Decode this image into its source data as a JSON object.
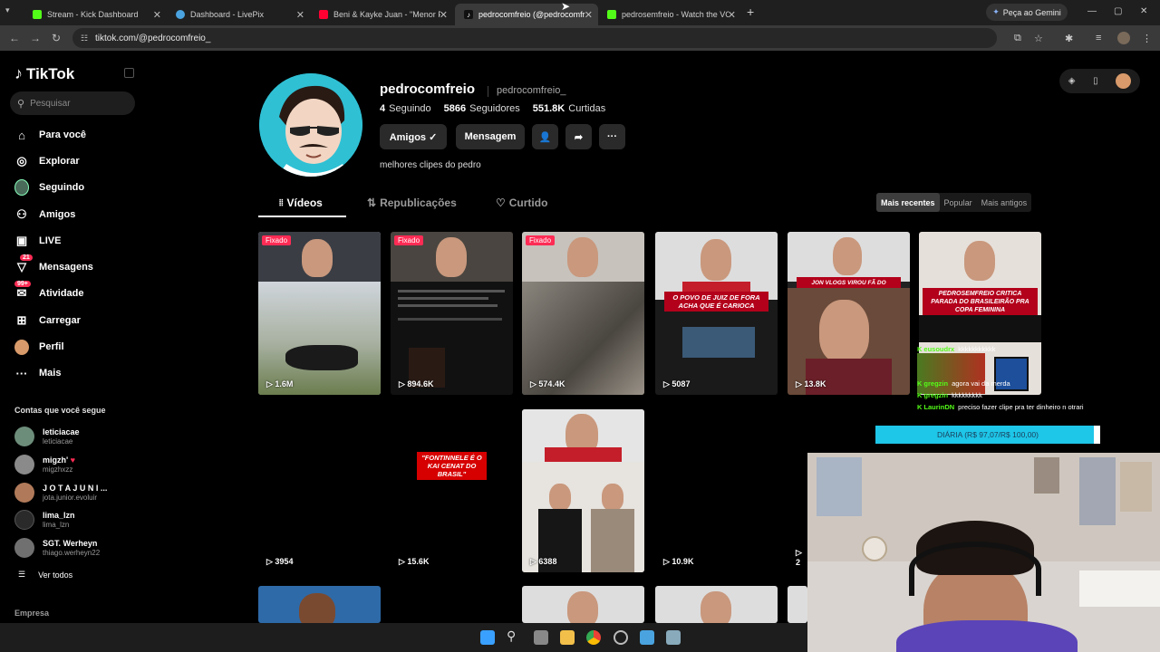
{
  "browser": {
    "tabs": [
      {
        "title": "Stream - Kick Dashboard",
        "color": "#53fc18"
      },
      {
        "title": "Dashboard - LivePix",
        "color": "#4aa3df"
      },
      {
        "title": "Beni & Kayke Juan - \"Menor Pr...",
        "color": "#ff0033"
      },
      {
        "title": "pedrocomfreio (@pedrocomfr...",
        "color": "#ffffff"
      },
      {
        "title": "pedrosemfreio - Watch the VOD",
        "color": "#53fc18"
      }
    ],
    "gemini_label": "Peça ao Gemini",
    "url": "tiktok.com/@pedrocomfreio_"
  },
  "sidebar": {
    "logo": "TikTok",
    "search_placeholder": "Pesquisar",
    "nav": [
      {
        "label": "Para você",
        "icon": "home-icon",
        "glyph": "⌂"
      },
      {
        "label": "Explorar",
        "icon": "compass-icon",
        "glyph": "◎"
      },
      {
        "label": "Seguindo",
        "icon": "following-avatar-icon",
        "glyph": ""
      },
      {
        "label": "Amigos",
        "icon": "friends-icon",
        "glyph": "👥"
      },
      {
        "label": "LIVE",
        "icon": "live-icon",
        "glyph": "▣"
      },
      {
        "label": "Mensagens",
        "icon": "messages-icon",
        "glyph": "✈",
        "badge": "21"
      },
      {
        "label": "Atividade",
        "icon": "activity-icon",
        "glyph": "✉",
        "badge": "99+"
      },
      {
        "label": "Carregar",
        "icon": "upload-icon",
        "glyph": "⊞"
      },
      {
        "label": "Perfil",
        "icon": "profile-avatar-icon",
        "glyph": ""
      },
      {
        "label": "Mais",
        "icon": "more-icon",
        "glyph": "···"
      }
    ],
    "following_heading": "Contas que você segue",
    "accounts": [
      {
        "name": "leticiacae",
        "handle": "leticiacae",
        "color": "#6c8d7a"
      },
      {
        "name": "migzh'",
        "handle": "migzhxzz",
        "color": "#8a8a8a"
      },
      {
        "name": "J O T A  J U N I ...",
        "handle": "jota.junior.evoluir",
        "color": "#b07a5a"
      },
      {
        "name": "lima_lzn",
        "handle": "lima_lzn",
        "color": "#2a2a2a"
      },
      {
        "name": "SGT. Werheyn",
        "handle": "thiago.werheyn22",
        "color": "#707070"
      }
    ],
    "see_all": "Ver todos",
    "company": "Empresa"
  },
  "profile": {
    "username": "pedrocomfreio",
    "handle": "pedrocomfreio_",
    "following_count": "4",
    "following_label": "Seguindo",
    "followers_count": "5866",
    "followers_label": "Seguidores",
    "likes_count": "551.8K",
    "likes_label": "Curtidas",
    "friends_button": "Amigos ✓",
    "message_button": "Mensagem",
    "bio": "melhores clipes do pedro",
    "tabs": [
      "Vídeos",
      "Republicações",
      "Curtido"
    ],
    "sort": [
      "Mais recentes",
      "Popular",
      "Mais antigos"
    ]
  },
  "videos": [
    {
      "views": "1.6M",
      "pinned": "Fixado"
    },
    {
      "views": "894.6K",
      "pinned": "Fixado"
    },
    {
      "views": "574.4K",
      "pinned": "Fixado"
    },
    {
      "views": "5087",
      "caption": "O POVO DE JUIZ DE FORA ACHA QUE É CARIOCA"
    },
    {
      "views": "13.8K",
      "caption": "JON VLOGS VIROU FÃ DO PEDROSEMFREIO"
    },
    {
      "caption": "PEDROSEMFREIO CRITICA PARADA DO BRASILEIRÃO PRA COPA FEMININA"
    },
    {
      "views": "3954"
    },
    {
      "views": "15.6K",
      "caption": "\"FONTINNELE É O KAI CENAT DO BRASIL\""
    },
    {
      "views": "6388"
    },
    {
      "views": "10.9K"
    },
    {
      "views": "2"
    }
  ],
  "stream_overlay": {
    "chat": [
      {
        "user": "eusoudrx",
        "msg": "kkkkkkkkkkk"
      },
      {
        "user": "gregzin",
        "msg": "agora vai da merda"
      },
      {
        "user": "gregzin",
        "msg": "kkkkkkkkk"
      },
      {
        "user": "LaurinDN",
        "msg": "preciso fazer clipe pra ter dinheiro n otrari"
      }
    ],
    "goal_text": "DIÁRIA (R$ 97,07/R$ 100,00)",
    "goal_progress": 0.9707
  }
}
